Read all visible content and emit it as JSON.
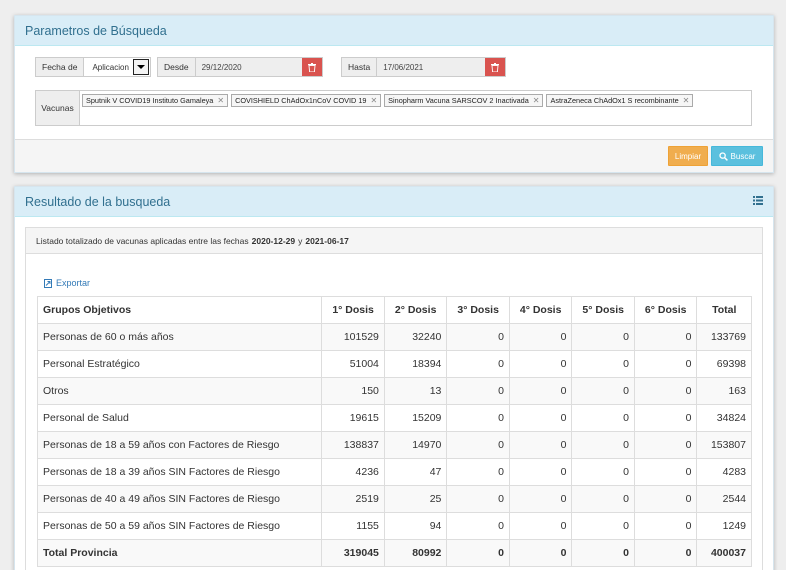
{
  "params": {
    "title": "Parametros de Búsqueda",
    "fecha_label": "Fecha de",
    "fecha_value": "Aplicacion",
    "desde_label": "Desde",
    "desde_value": "29/12/2020",
    "hasta_label": "Hasta",
    "hasta_value": "17/06/2021",
    "vacunas_label": "Vacunas",
    "vacunas": [
      "Sputnik V COVID19 Instituto Gamaleya",
      "COVISHIELD ChAdOx1nCoV COVID 19",
      "Sinopharm Vacuna SARSCOV 2 Inactivada",
      "AstraZeneca ChAdOx1 S recombinante"
    ],
    "limpiar_label": "Limpiar",
    "buscar_label": "Buscar"
  },
  "results": {
    "title": "Resultado de la busqueda",
    "summary_prefix": "Listado totalizado de vacunas aplicadas entre las fechas",
    "date_from": "2020-12-29",
    "summary_and": "y",
    "date_to": "2021-06-17",
    "export_label": "Exportar",
    "columns": [
      "Grupos Objetivos",
      "1° Dosis",
      "2° Dosis",
      "3° Dosis",
      "4° Dosis",
      "5° Dosis",
      "6° Dosis",
      "Total"
    ],
    "rows": [
      [
        "Personas de 60 o más años",
        "101529",
        "32240",
        "0",
        "0",
        "0",
        "0",
        "133769"
      ],
      [
        "Personal Estratégico",
        "51004",
        "18394",
        "0",
        "0",
        "0",
        "0",
        "69398"
      ],
      [
        "Otros",
        "150",
        "13",
        "0",
        "0",
        "0",
        "0",
        "163"
      ],
      [
        "Personal de Salud",
        "19615",
        "15209",
        "0",
        "0",
        "0",
        "0",
        "34824"
      ],
      [
        "Personas de 18 a 59 años con Factores de Riesgo",
        "138837",
        "14970",
        "0",
        "0",
        "0",
        "0",
        "153807"
      ],
      [
        "Personas de 18 a 39 años SIN Factores de Riesgo",
        "4236",
        "47",
        "0",
        "0",
        "0",
        "0",
        "4283"
      ],
      [
        "Personas de 40 a 49 años SIN Factores de Riesgo",
        "2519",
        "25",
        "0",
        "0",
        "0",
        "0",
        "2544"
      ],
      [
        "Personas de 50 a 59 años SIN Factores de Riesgo",
        "1155",
        "94",
        "0",
        "0",
        "0",
        "0",
        "1249"
      ],
      [
        "Total Provincia",
        "319045",
        "80992",
        "0",
        "0",
        "0",
        "0",
        "400037"
      ]
    ]
  },
  "colors": {
    "panel_heading": "#d9edf7",
    "panel_title": "#31708f",
    "danger": "#d9534f",
    "warning": "#f0ad4e",
    "info": "#5bc0de",
    "link": "#337ab7"
  },
  "icons": {
    "trash": "trash-icon",
    "search": "search-icon",
    "list": "list-icon",
    "export": "file-export-icon"
  }
}
